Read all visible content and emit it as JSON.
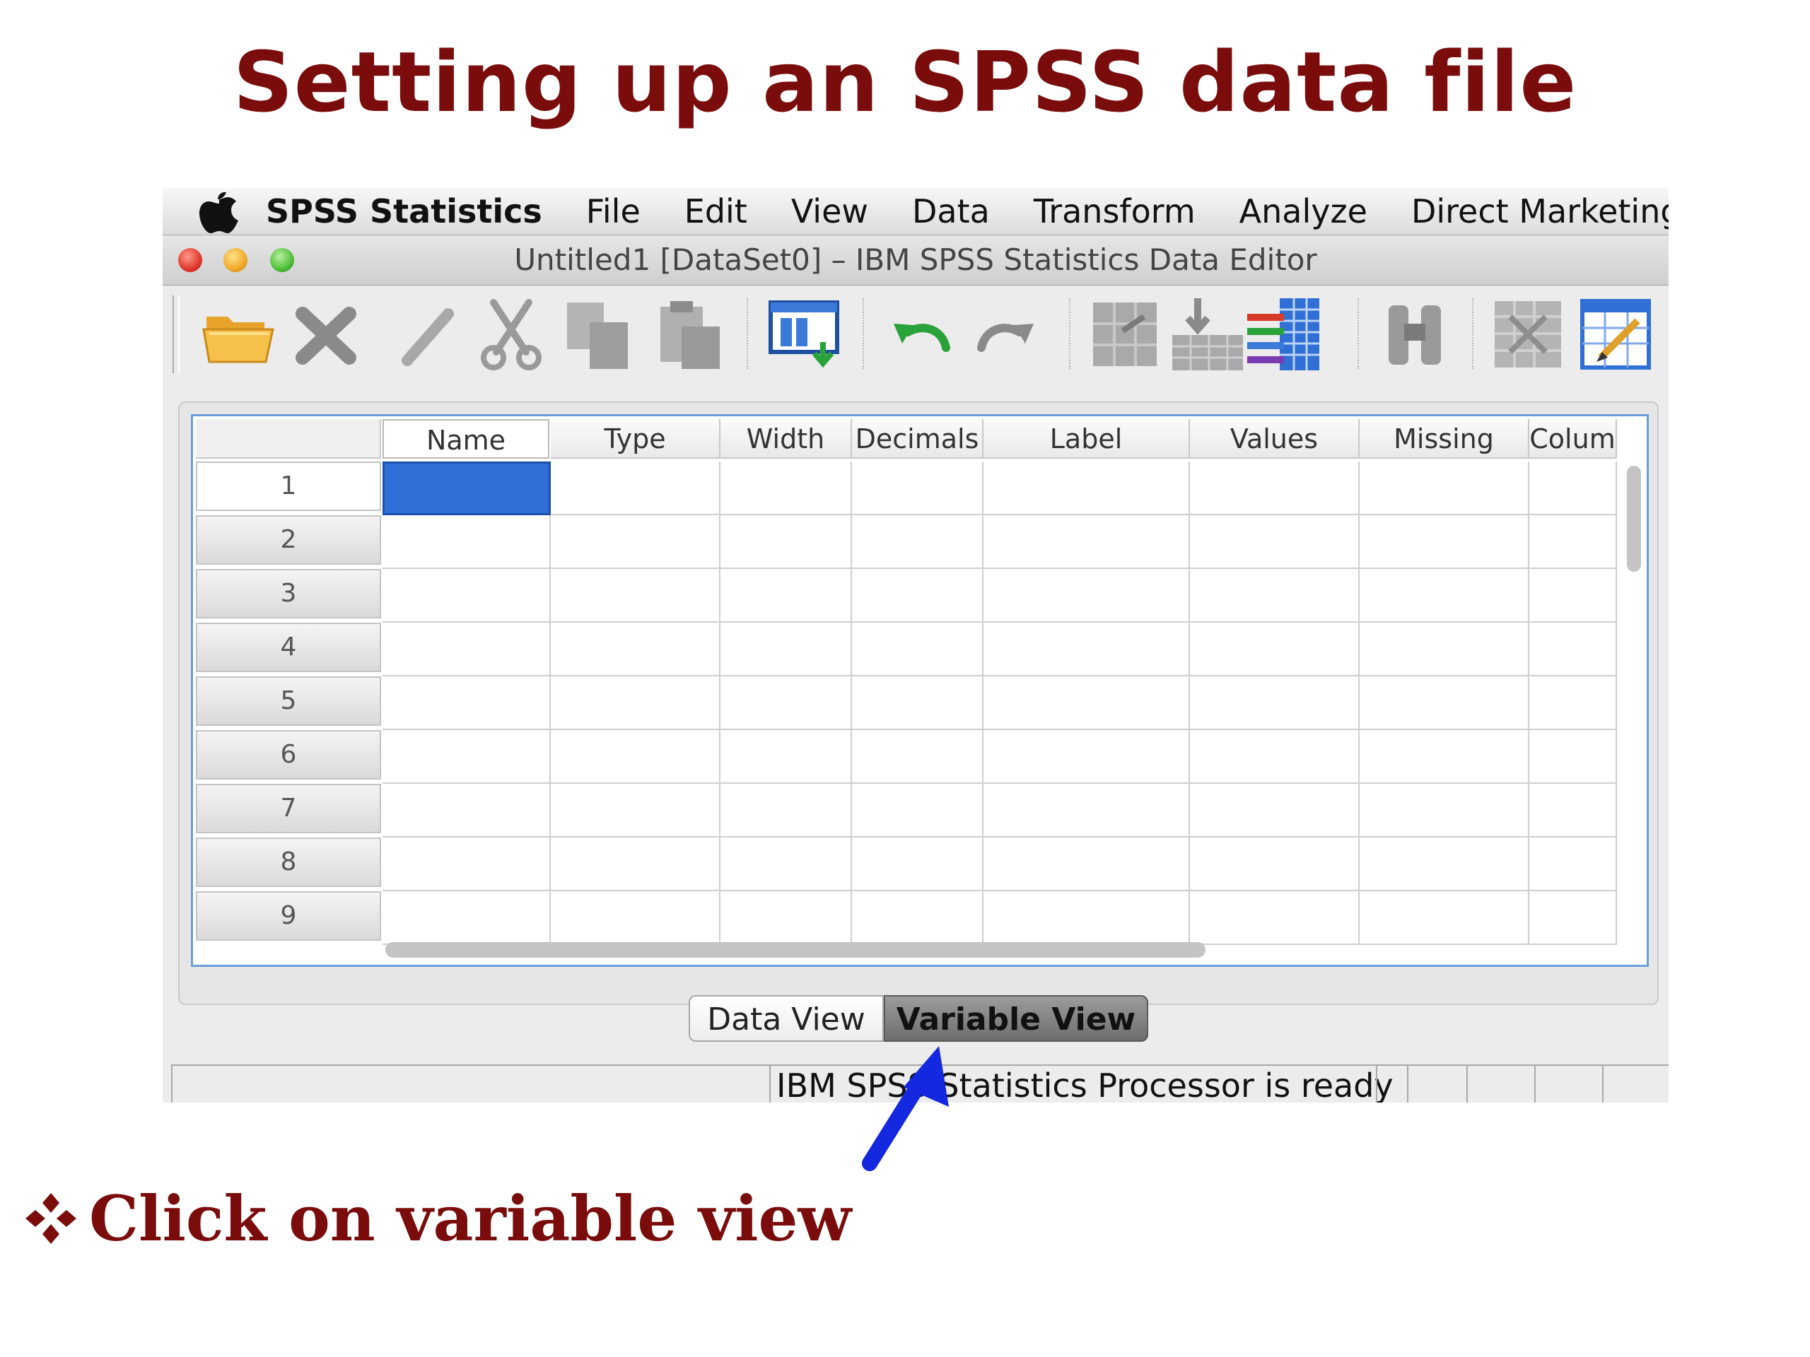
{
  "slide": {
    "title": "Setting up an SPSS data file",
    "bullet": "Click on variable view",
    "accent_color": "#7a0c0c"
  },
  "menubar": {
    "apple_icon": "apple-logo-icon",
    "items": [
      "SPSS Statistics",
      "File",
      "Edit",
      "View",
      "Data",
      "Transform",
      "Analyze",
      "Direct Marketing"
    ]
  },
  "window": {
    "title": "Untitled1 [DataSet0] – IBM SPSS Statistics Data Editor"
  },
  "toolbar": {
    "icons": [
      "open-folder-icon",
      "delete-icon",
      "edit-icon",
      "cut-icon",
      "copy-icon",
      "paste-icon",
      "variable-view-icon",
      "undo-icon",
      "redo-icon",
      "goto-case-icon",
      "insert-cases-icon",
      "insert-variable-icon",
      "find-icon",
      "split-file-icon",
      "value-labels-icon"
    ]
  },
  "grid": {
    "columns": [
      "Name",
      "Type",
      "Width",
      "Decimals",
      "Label",
      "Values",
      "Missing",
      "Colum"
    ],
    "rows": [
      "1",
      "2",
      "3",
      "4",
      "5",
      "6",
      "7",
      "8",
      "9"
    ],
    "selected_cell": {
      "row": "1",
      "column": "Name"
    },
    "selection_color": "#2f6fd6"
  },
  "tabs": {
    "data_view": "Data View",
    "variable_view": "Variable View",
    "active": "Variable View"
  },
  "status": {
    "text": "IBM SPSS Statistics Processor is ready"
  },
  "annotation": {
    "arrow_color": "#1428e0"
  }
}
